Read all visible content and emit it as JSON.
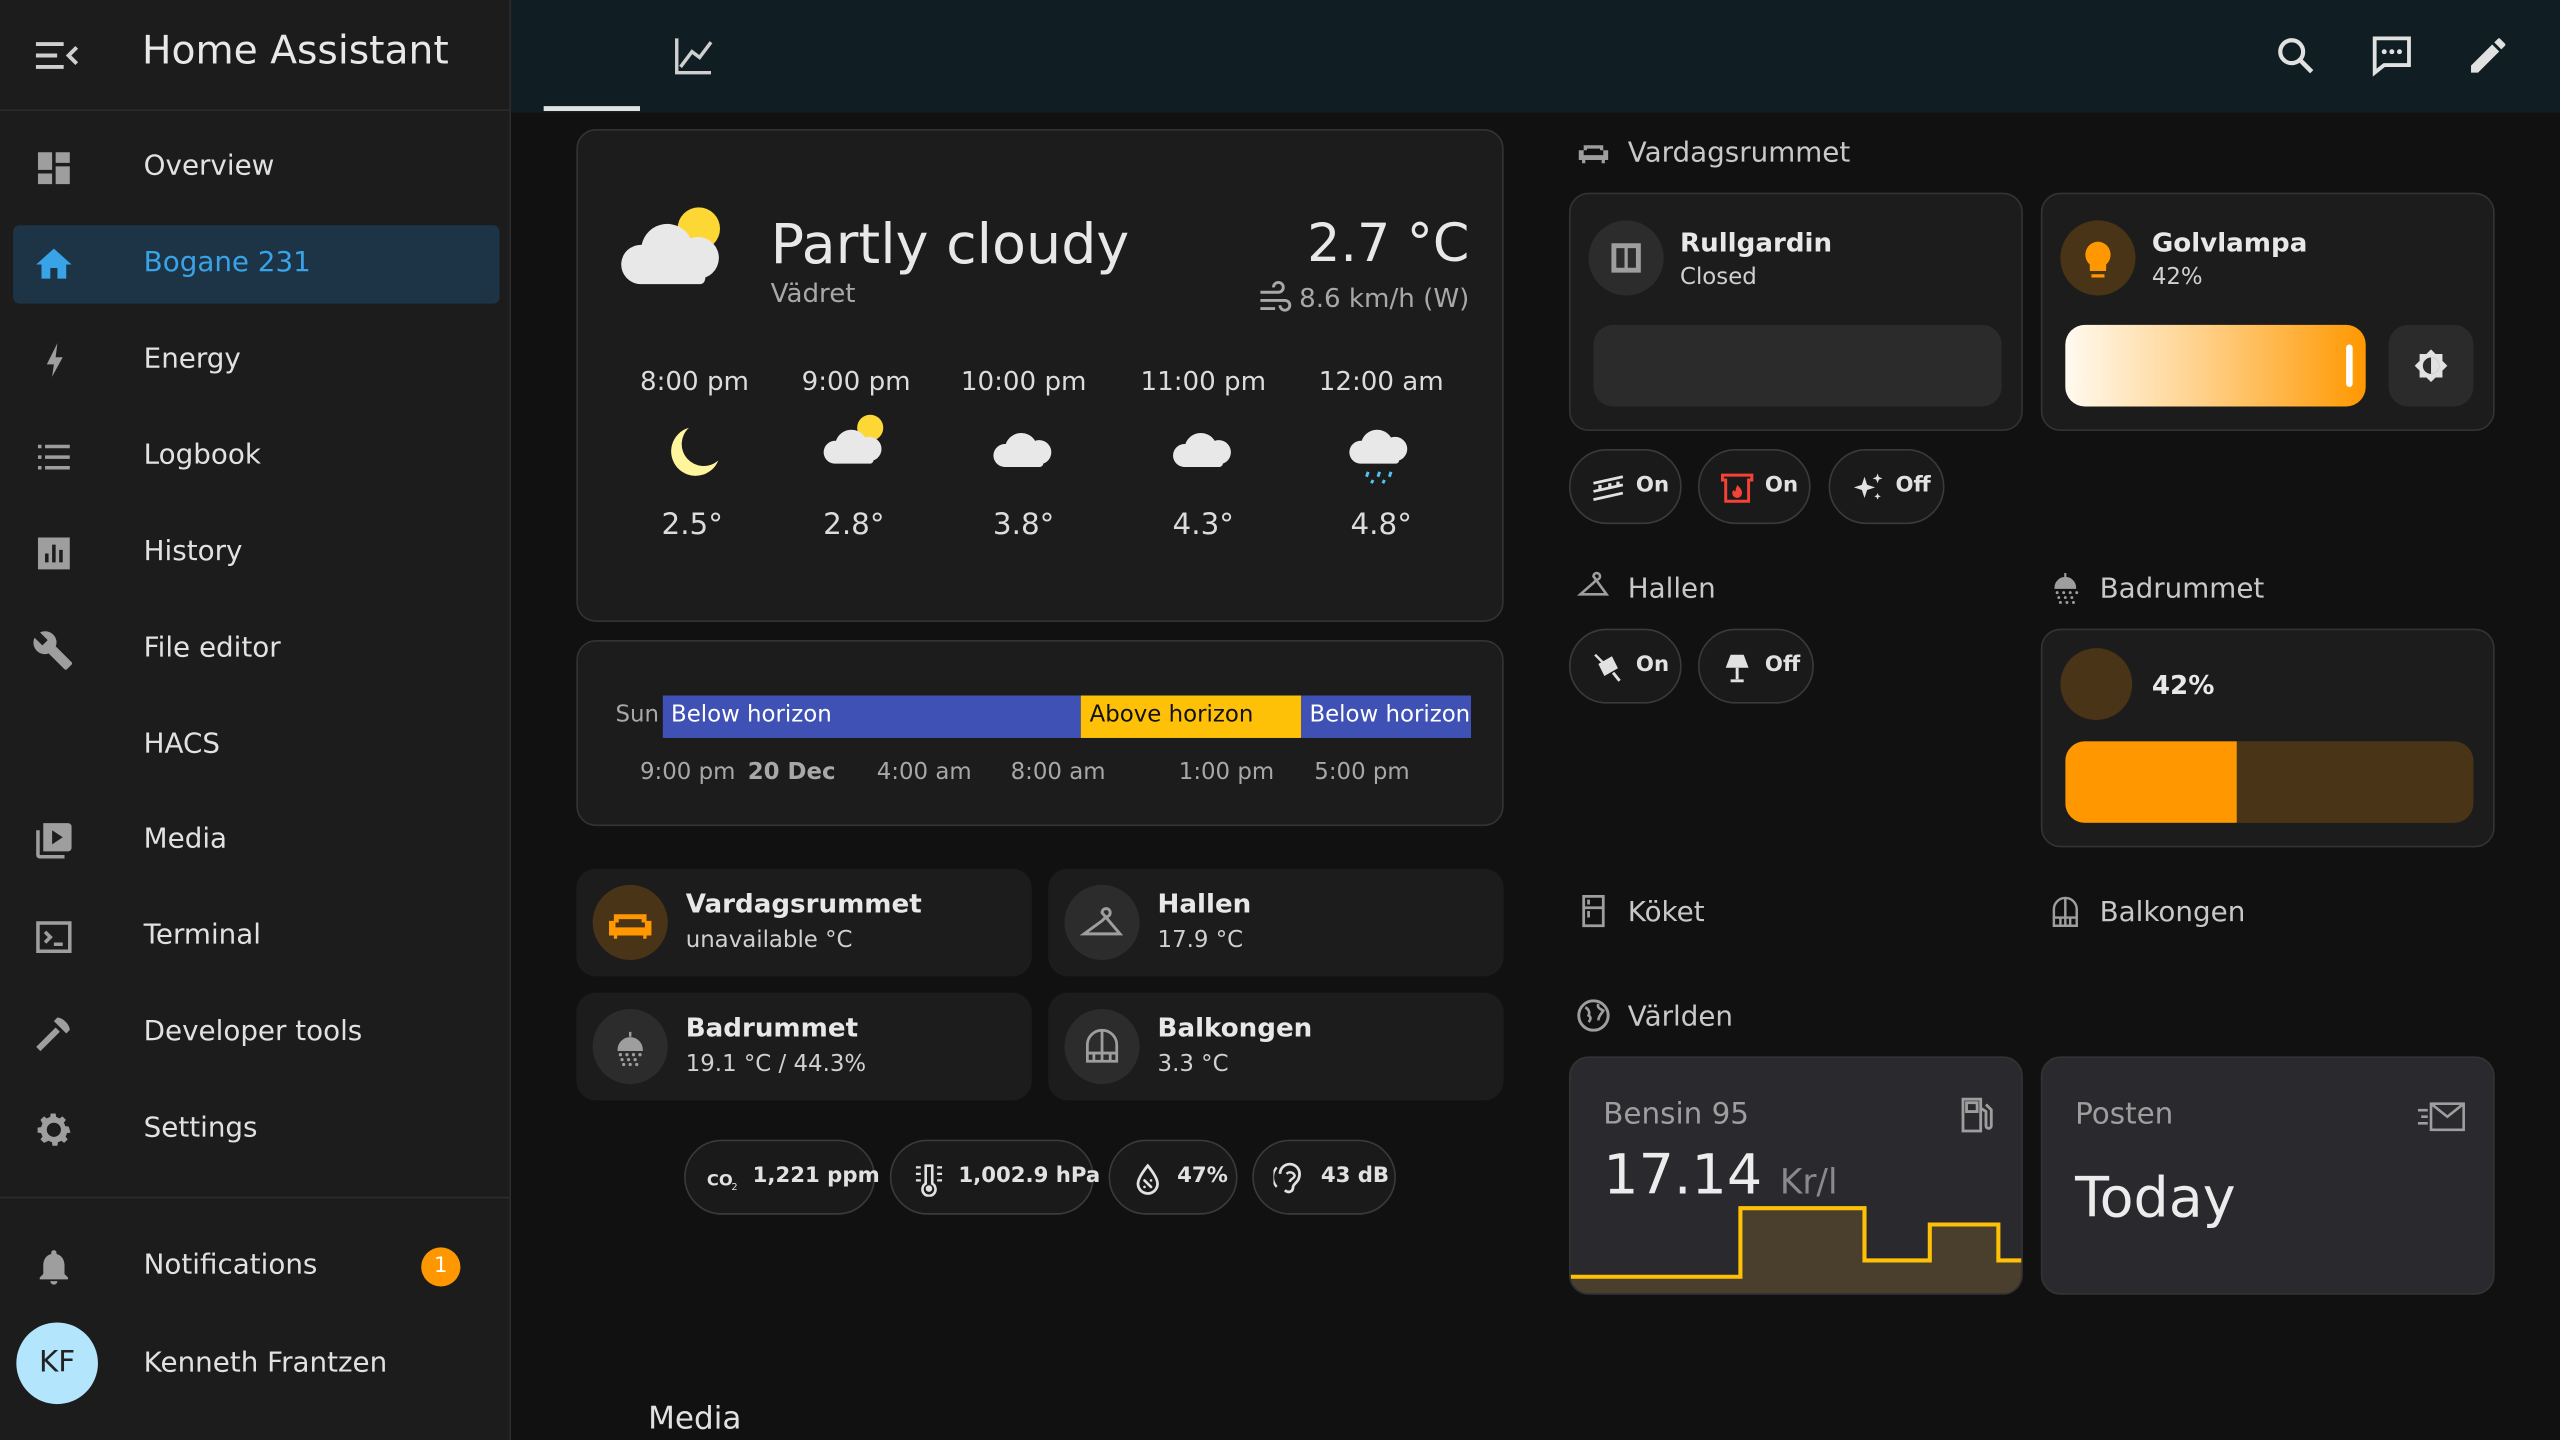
{
  "app": {
    "title": "Home Assistant"
  },
  "sidebar": {
    "items": [
      {
        "label": "Overview"
      },
      {
        "label": "Bogane 231"
      },
      {
        "label": "Energy"
      },
      {
        "label": "Logbook"
      },
      {
        "label": "History"
      },
      {
        "label": "File editor"
      },
      {
        "label": "HACS"
      },
      {
        "label": "Media"
      },
      {
        "label": "Terminal"
      },
      {
        "label": "Developer tools"
      },
      {
        "label": "Settings"
      }
    ],
    "notifications": {
      "label": "Notifications",
      "count": "1"
    },
    "user": {
      "initials": "KF",
      "name": "Kenneth Frantzen"
    }
  },
  "weather": {
    "condition": "Partly cloudy",
    "entity": "Vädret",
    "temperature": "2.7 °C",
    "wind": "8.6 km/h (W)",
    "forecast": [
      {
        "time": "8:00 pm",
        "temp": "2.5°",
        "icon": "night-moon-icon"
      },
      {
        "time": "9:00 pm",
        "temp": "2.8°",
        "icon": "partly-cloudy-icon"
      },
      {
        "time": "10:00 pm",
        "temp": "3.8°",
        "icon": "cloudy-icon"
      },
      {
        "time": "11:00 pm",
        "temp": "4.3°",
        "icon": "cloudy-icon"
      },
      {
        "time": "12:00 am",
        "temp": "4.8°",
        "icon": "rainy-icon"
      }
    ]
  },
  "sun_timeline": {
    "label": "Sun",
    "segments": [
      {
        "label": "Below horizon",
        "color": "#3f51b5",
        "fraction": 0.518
      },
      {
        "label": "Above horizon",
        "color": "#ffc107",
        "fraction": 0.272
      },
      {
        "label": "Below horizon",
        "color": "#3f51b5",
        "fraction": 0.21
      }
    ],
    "ticks": [
      "9:00 pm",
      "20 Dec",
      "4:00 am",
      "8:00 am",
      "1:00 pm",
      "5:00 pm"
    ]
  },
  "area_tiles": [
    {
      "name": "Vardagsrummet",
      "state": "unavailable °C",
      "icon": "sofa-icon"
    },
    {
      "name": "Hallen",
      "state": "17.9 °C",
      "icon": "hanger-icon"
    },
    {
      "name": "Badrummet",
      "state": "19.1 °C / 44.3%",
      "icon": "shower-icon"
    },
    {
      "name": "Balkongen",
      "state": "3.3 °C",
      "icon": "balcony-icon"
    }
  ],
  "sensor_pills": [
    {
      "label": "1,221 ppm",
      "icon": "co2-icon"
    },
    {
      "label": "1,002.9 hPa",
      "icon": "pressure-icon"
    },
    {
      "label": "47%",
      "icon": "humidity-icon"
    },
    {
      "label": "43 dB",
      "icon": "ear-icon"
    }
  ],
  "media_section": {
    "title": "Media"
  },
  "vardagsrummet": {
    "title": "Vardagsrummet",
    "blind": {
      "name": "Rullgardin",
      "state": "Closed",
      "position": 0
    },
    "lamp": {
      "name": "Golvlampa",
      "state": "42%",
      "brightness": 0.42
    },
    "pills": [
      {
        "label": "On",
        "icon": "led-strip-icon"
      },
      {
        "label": "On",
        "icon": "fireplace-icon"
      },
      {
        "label": "Off",
        "icon": "sparkle-icon"
      }
    ]
  },
  "hallen": {
    "title": "Hallen",
    "pills": [
      {
        "label": "On",
        "icon": "ceiling-light-icon"
      },
      {
        "label": "Off",
        "icon": "lamp-icon"
      }
    ]
  },
  "badrummet": {
    "title": "Badrummet",
    "state": "42%",
    "level": 0.42
  },
  "koket": {
    "title": "Köket"
  },
  "balkongen": {
    "title": "Balkongen"
  },
  "varlden": {
    "title": "Världen",
    "fuel": {
      "name": "Bensin 95",
      "value": "17.14",
      "unit": "Kr/l"
    },
    "post": {
      "name": "Posten",
      "value": "Today"
    }
  },
  "colors": {
    "accent": "#39a3e8",
    "orange": "#ff9800",
    "amber": "#ffc107",
    "indigo": "#3f51b5",
    "background": "#111111",
    "card": "#1c1c1c"
  }
}
